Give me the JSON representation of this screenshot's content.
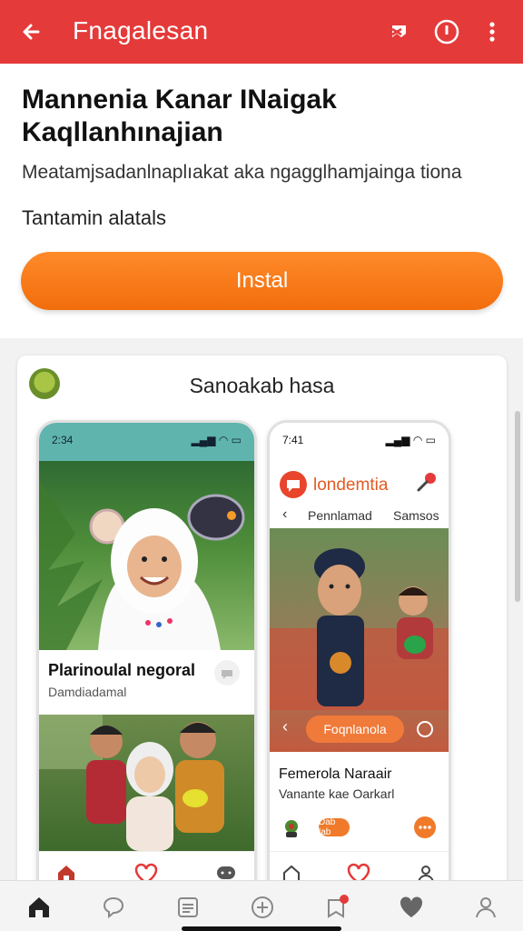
{
  "appbar": {
    "title": "Fnagalesan",
    "icons": [
      "arrow-left-icon",
      "tag-icon",
      "info-icon",
      "more-vertical-icon"
    ]
  },
  "hero": {
    "headline": "Mannenia Kanar INaigak Kaqllanhınajian",
    "subtitle": "Meatamjsadanlnaplıakat aka ngagglhamjainga tiona",
    "meta": "Tantamin alatals",
    "install_label": "Instal"
  },
  "preview": {
    "title": "Sanoakab hasa",
    "phone1": {
      "time": "2:34",
      "post1_title": "Plarinoulal negoral",
      "post1_sub": "Damdiadamal",
      "bottom_icons": [
        "home-icon",
        "heart-icon",
        "chat-icon"
      ]
    },
    "phone2": {
      "time": "7:41",
      "app_name": "londemtia",
      "tab_left": "Pennlamad",
      "tab_right": "Samsos",
      "photo_button": "Foqnlanola",
      "post_title": "Femerola Naraair",
      "post_sub": "Vanante kae Oarkarl",
      "chip_label": "Dab lab",
      "bottom_icons": [
        "home-icon",
        "heart-icon",
        "person-icon"
      ]
    }
  },
  "navbar": {
    "icons": [
      "home-icon",
      "chat-icon",
      "news-icon",
      "add-icon",
      "notification-icon",
      "heart-icon",
      "profile-icon"
    ]
  },
  "colors": {
    "brand_red": "#e53a3a",
    "accent_orange": "#f57c1f"
  }
}
